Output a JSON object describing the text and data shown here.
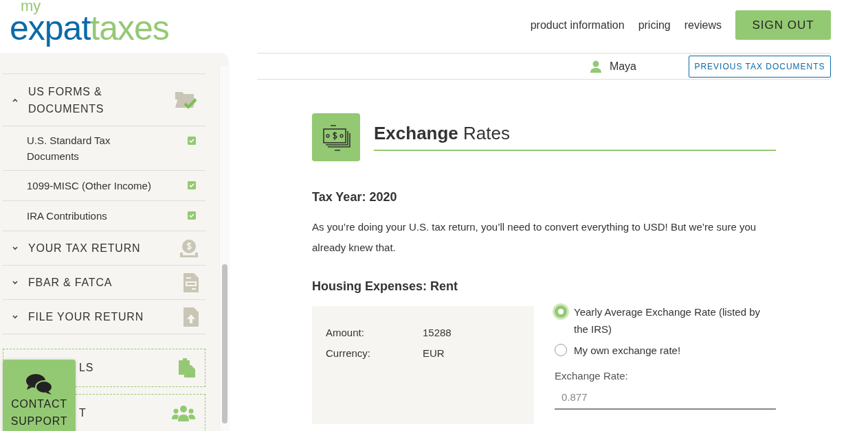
{
  "logo": {
    "top": "my",
    "first": "expat",
    "second": "taxes"
  },
  "nav": {
    "links": [
      "product information",
      "pricing",
      "reviews"
    ],
    "button": "SIGN OUT"
  },
  "user": {
    "name": "Maya",
    "button": "PREVIOUS TAX DOCUMENTS"
  },
  "sidebar": {
    "items": [
      {
        "kind": "section",
        "label": "US FORMS & DOCUMENTS",
        "expanded": true,
        "children": [
          {
            "label": "U.S. Standard Tax Documents",
            "checked": true
          },
          {
            "label": "1099-MISC (Other Income)",
            "checked": true
          },
          {
            "label": "IRA Contributions",
            "checked": true
          }
        ]
      },
      {
        "kind": "section",
        "label": "YOUR TAX RETURN",
        "expanded": false
      },
      {
        "kind": "section",
        "label": "FBAR & FATCA",
        "expanded": false
      },
      {
        "kind": "section",
        "label": "FILE YOUR RETURN",
        "expanded": false
      },
      {
        "kind": "tool",
        "label": "LS"
      },
      {
        "kind": "tool",
        "label": "T"
      }
    ]
  },
  "contact_support": {
    "label": "CONTACT SUPPORT"
  },
  "page": {
    "title": "**Exchange** Rates",
    "tax_year": "Tax Year: 2020",
    "intro": "As you’re doing your U.S. tax return, you’ll need to convert everything to USD! But we’re sure you already knew that.",
    "section": "Housing Expenses: Rent",
    "details": [
      {
        "label": "Amount:",
        "value": "15288"
      },
      {
        "label": "Currency:",
        "value": "EUR"
      }
    ],
    "options": [
      {
        "label": "Yearly Average Exchange Rate (listed by the IRS)",
        "selected": true
      },
      {
        "label": "My own exchange rate!",
        "selected": false
      }
    ],
    "rate_field": {
      "label": "Exchange Rate:",
      "placeholder": "0.877"
    }
  }
}
